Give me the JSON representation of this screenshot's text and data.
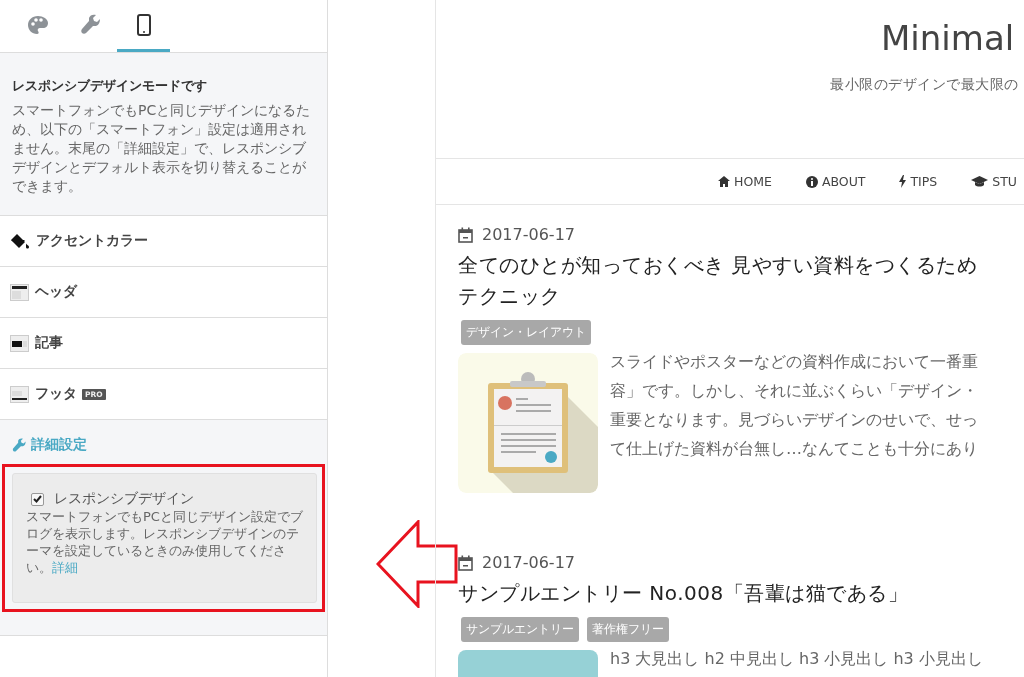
{
  "sidebar": {
    "tabs": [
      {
        "kind": "palette",
        "selected": false
      },
      {
        "kind": "wrench",
        "selected": false
      },
      {
        "kind": "phone",
        "selected": true
      }
    ],
    "notice": {
      "title": "レスポンシブデザインモードです",
      "text": "スマートフォンでもPCと同じデザインになるため、以下の「スマートフォン」設定は適用されません。末尾の「詳細設定」で、レスポンシブデザインとデフォルト表示を切り替えることができます。"
    },
    "sections": [
      {
        "kind": "accent",
        "label": "アクセントカラー"
      },
      {
        "kind": "header",
        "label": "ヘッダ"
      },
      {
        "kind": "article",
        "label": "記事"
      },
      {
        "kind": "footer",
        "label": "フッタ",
        "badge": "PRO"
      }
    ],
    "advanced": {
      "heading": "詳細設定",
      "option": {
        "label": "レスポンシブデザイン",
        "checked": true,
        "description": "スマートフォンでもPCと同じデザイン設定でブログを表示します。レスポンシブデザインのテーマを設定しているときのみ使用してください。",
        "link": "詳細"
      }
    }
  },
  "preview": {
    "site_title": "Minimal",
    "tagline": "最小限のデザインで最大限の",
    "nav": [
      {
        "kind": "home",
        "label": "HOME"
      },
      {
        "kind": "info",
        "label": "ABOUT"
      },
      {
        "kind": "bolt",
        "label": "TIPS"
      },
      {
        "kind": "cap",
        "label": "STU"
      }
    ],
    "posts": [
      {
        "date": "2017-06-17",
        "title_lines": [
          "全てのひとが知っておくべき 見やすい資料をつくるため",
          "テクニック"
        ],
        "tags": [
          "デザイン・レイアウト"
        ],
        "thumbnail": {
          "kind": "clipboard"
        },
        "excerpt_lines": [
          "スライドやポスターなどの資料作成において一番重",
          "容」です。しかし、それに並ぶくらい「デザイン・",
          "重要となります。見づらいデザインのせいで、せっ",
          "て仕上げた資料が台無し…なんてことも十分にあり"
        ]
      },
      {
        "date": "2017-06-17",
        "title_lines": [
          "サンプルエントリー No.008「吾輩は猫である」"
        ],
        "tags": [
          "サンプルエントリー",
          "著作権フリー"
        ],
        "thumbnail": {
          "kind": "block"
        },
        "excerpt_lines": [
          "h3 大見出し h2 中見出し h3 小見出し h3 小見出し"
        ]
      }
    ]
  }
}
